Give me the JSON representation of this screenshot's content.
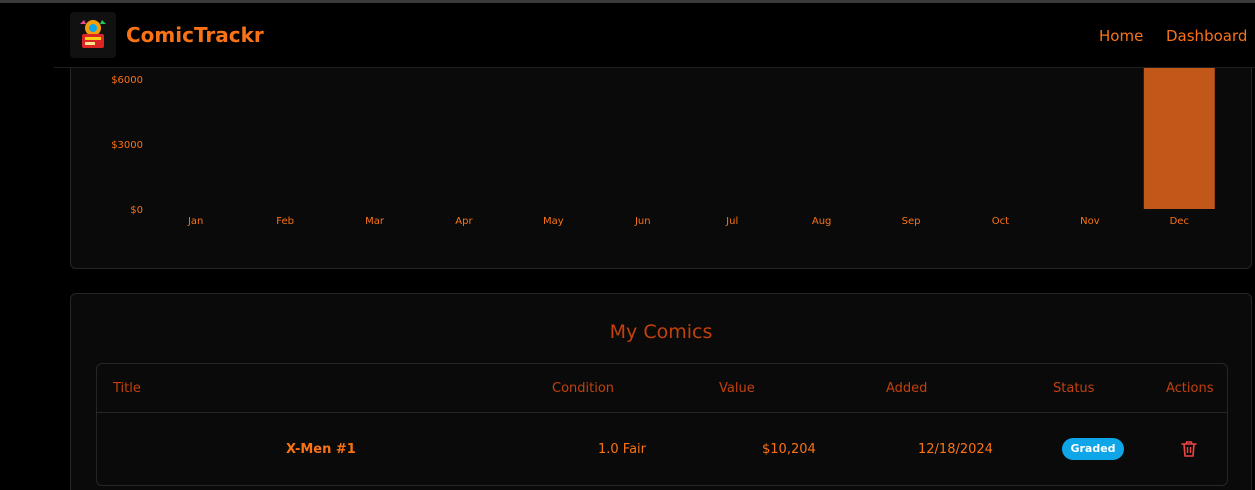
{
  "app": {
    "brand": "ComicTrackr"
  },
  "nav": {
    "home": "Home",
    "dashboard": "Dashboard"
  },
  "colors": {
    "accent": "#f97316",
    "bar": "#c2571a",
    "badge": "#0ea5e9",
    "background": "#000000"
  },
  "chart_data": {
    "type": "bar",
    "categories": [
      "Jan",
      "Feb",
      "Mar",
      "Apr",
      "May",
      "Jun",
      "Jul",
      "Aug",
      "Sep",
      "Oct",
      "Nov",
      "Dec"
    ],
    "values": [
      0,
      0,
      0,
      0,
      0,
      0,
      0,
      0,
      0,
      0,
      0,
      10204
    ],
    "ytick_labels": [
      "$0",
      "$3000",
      "$6000"
    ],
    "yticks": [
      0,
      3000,
      6000
    ],
    "ylim": [
      0,
      9000
    ],
    "grid": false
  },
  "comics": {
    "title": "My Comics",
    "columns": [
      "Title",
      "Condition",
      "Value",
      "Added",
      "Status",
      "Actions"
    ],
    "rows": [
      {
        "title": "X-Men #1",
        "condition": "1.0 Fair",
        "value": "$10,204",
        "added": "12/18/2024",
        "status": "Graded",
        "action_icon": "trash-icon"
      }
    ]
  }
}
